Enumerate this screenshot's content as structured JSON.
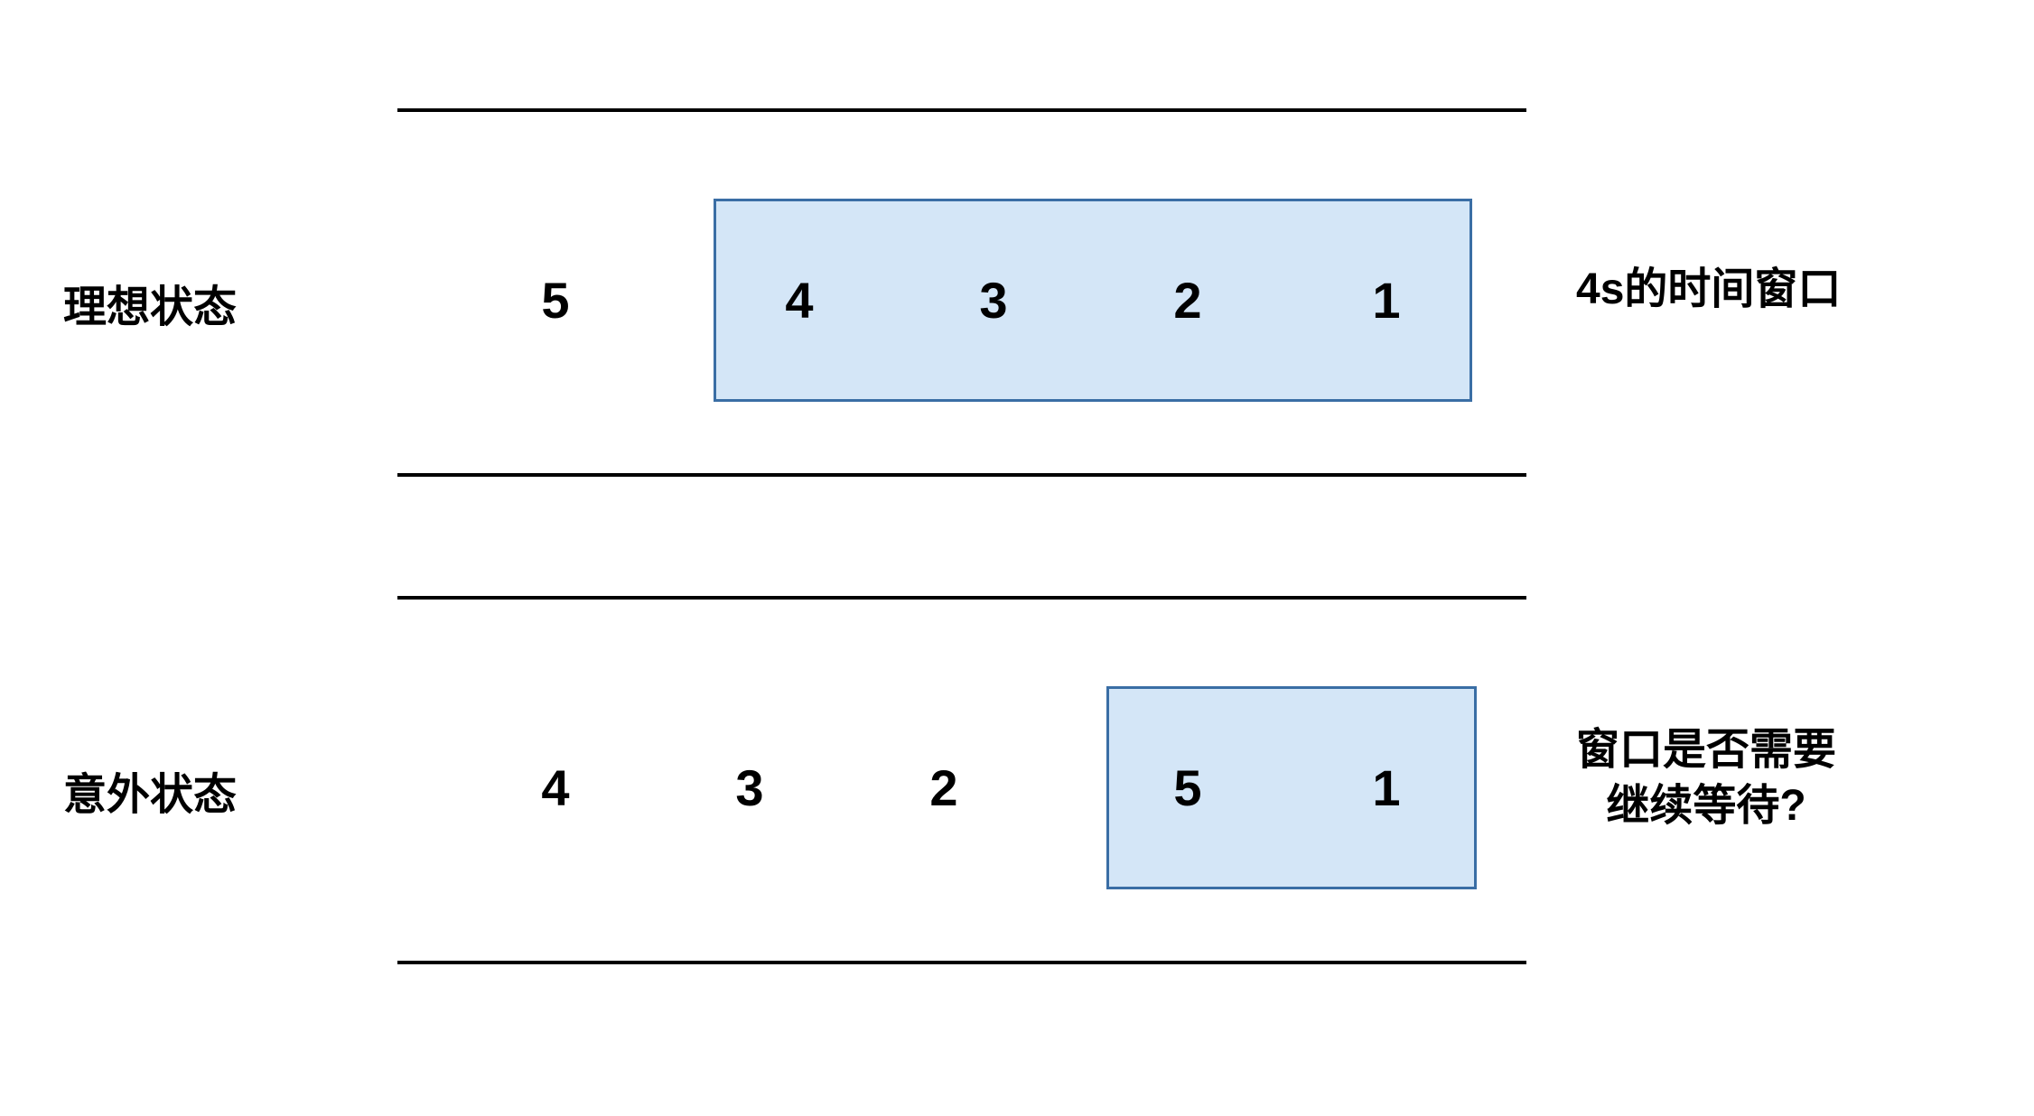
{
  "row1": {
    "label": "理想状态",
    "rightLabel": "4s的时间窗口",
    "numbers": [
      "5",
      "4",
      "3",
      "2",
      "1"
    ]
  },
  "row2": {
    "label": "意外状态",
    "rightLabelLine1": "窗口是否需要",
    "rightLabelLine2": "继续等待?",
    "numbers": [
      "4",
      "3",
      "2",
      "5",
      "1"
    ]
  }
}
